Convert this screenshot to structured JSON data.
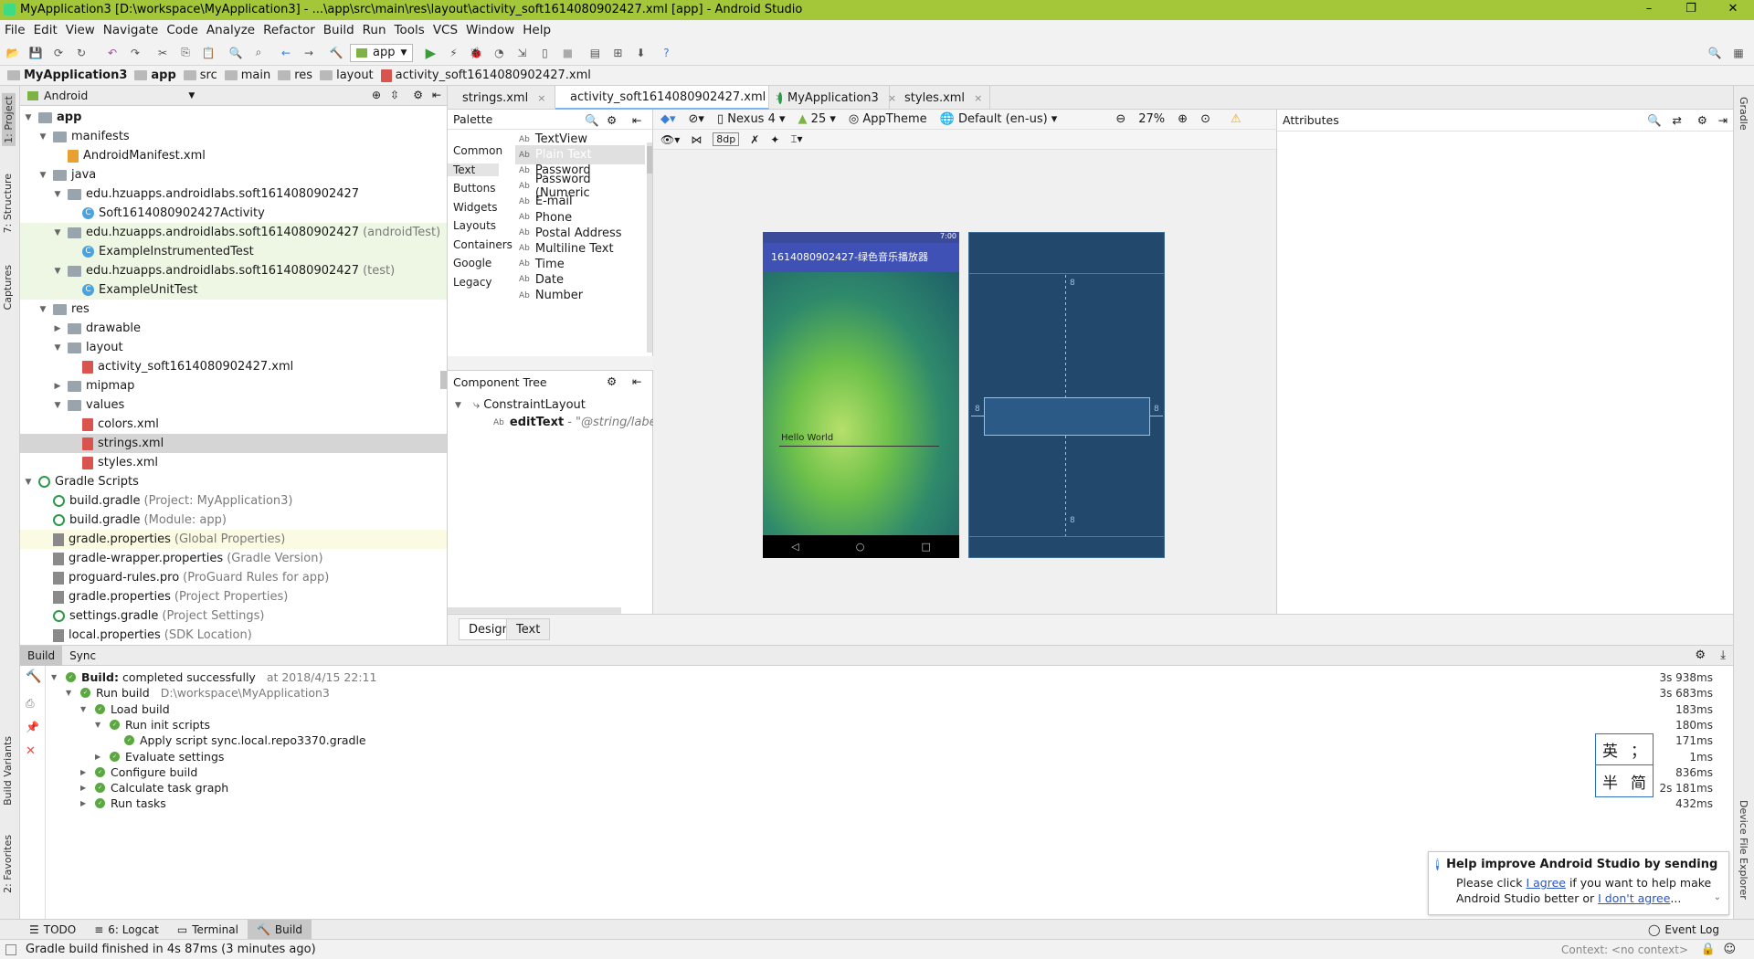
{
  "window": {
    "title": "MyApplication3 [D:\\workspace\\MyApplication3] - ...\\app\\src\\main\\res\\layout\\activity_soft1614080902427.xml [app] - Android Studio"
  },
  "menu": [
    "File",
    "Edit",
    "View",
    "Navigate",
    "Code",
    "Analyze",
    "Refactor",
    "Build",
    "Run",
    "Tools",
    "VCS",
    "Window",
    "Help"
  ],
  "toolbar": {
    "run_config": "app"
  },
  "breadcrumb": [
    "MyApplication3",
    "app",
    "src",
    "main",
    "res",
    "layout",
    "activity_soft1614080902427.xml"
  ],
  "project": {
    "view_mode": "Android",
    "tree": [
      {
        "label": "app",
        "depth": 0,
        "icon": "folder",
        "arrow": "v",
        "bold": true
      },
      {
        "label": "manifests",
        "depth": 1,
        "icon": "folder",
        "arrow": "v"
      },
      {
        "label": "AndroidManifest.xml",
        "depth": 2,
        "icon": "file",
        "arrow": ""
      },
      {
        "label": "java",
        "depth": 1,
        "icon": "folder",
        "arrow": "v"
      },
      {
        "label": "edu.hzuapps.androidlabs.soft1614080902427",
        "depth": 2,
        "icon": "folder",
        "arrow": "v"
      },
      {
        "label": "Soft1614080902427Activity",
        "depth": 3,
        "icon": "class",
        "arrow": ""
      },
      {
        "label": "edu.hzuapps.androidlabs.soft1614080902427",
        "suffix": "(androidTest)",
        "depth": 2,
        "icon": "folder",
        "arrow": "v",
        "hl": true
      },
      {
        "label": "ExampleInstrumentedTest",
        "depth": 3,
        "icon": "class",
        "arrow": "",
        "hl": true
      },
      {
        "label": "edu.hzuapps.androidlabs.soft1614080902427",
        "suffix": "(test)",
        "depth": 2,
        "icon": "folder",
        "arrow": "v",
        "hl": true
      },
      {
        "label": "ExampleUnitTest",
        "depth": 3,
        "icon": "class",
        "arrow": "",
        "hl": true
      },
      {
        "label": "res",
        "depth": 1,
        "icon": "folder",
        "arrow": "v"
      },
      {
        "label": "drawable",
        "depth": 2,
        "icon": "folder",
        "arrow": ">"
      },
      {
        "label": "layout",
        "depth": 2,
        "icon": "folder",
        "arrow": "v"
      },
      {
        "label": "activity_soft1614080902427.xml",
        "depth": 3,
        "icon": "xml",
        "arrow": ""
      },
      {
        "label": "mipmap",
        "depth": 2,
        "icon": "folder",
        "arrow": ">"
      },
      {
        "label": "values",
        "depth": 2,
        "icon": "folder",
        "arrow": "v"
      },
      {
        "label": "colors.xml",
        "depth": 3,
        "icon": "xml",
        "arrow": ""
      },
      {
        "label": "strings.xml",
        "depth": 3,
        "icon": "xml",
        "arrow": "",
        "sel": true
      },
      {
        "label": "styles.xml",
        "depth": 3,
        "icon": "xml",
        "arrow": ""
      },
      {
        "label": "Gradle Scripts",
        "depth": 0,
        "icon": "gradle",
        "arrow": "v"
      },
      {
        "label": "build.gradle",
        "suffix": "(Project: MyApplication3)",
        "depth": 1,
        "icon": "gradle",
        "arrow": ""
      },
      {
        "label": "build.gradle",
        "suffix": "(Module: app)",
        "depth": 1,
        "icon": "gradle",
        "arrow": ""
      },
      {
        "label": "gradle.properties",
        "suffix": "(Global Properties)",
        "depth": 1,
        "icon": "prop",
        "arrow": "",
        "yl": true
      },
      {
        "label": "gradle-wrapper.properties",
        "suffix": "(Gradle Version)",
        "depth": 1,
        "icon": "prop",
        "arrow": ""
      },
      {
        "label": "proguard-rules.pro",
        "suffix": "(ProGuard Rules for app)",
        "depth": 1,
        "icon": "prop",
        "arrow": ""
      },
      {
        "label": "gradle.properties",
        "suffix": "(Project Properties)",
        "depth": 1,
        "icon": "prop",
        "arrow": ""
      },
      {
        "label": "settings.gradle",
        "suffix": "(Project Settings)",
        "depth": 1,
        "icon": "gradle",
        "arrow": ""
      },
      {
        "label": "local.properties",
        "suffix": "(SDK Location)",
        "depth": 1,
        "icon": "prop",
        "arrow": ""
      }
    ]
  },
  "editor_tabs": [
    {
      "label": "strings.xml"
    },
    {
      "label": "activity_soft1614080902427.xml",
      "active": true
    },
    {
      "label": "MyApplication3"
    },
    {
      "label": "styles.xml"
    }
  ],
  "palette": {
    "title": "Palette",
    "categories": [
      "Common",
      "Text",
      "Buttons",
      "Widgets",
      "Layouts",
      "Containers",
      "Google",
      "Legacy"
    ],
    "selected_category": "Text",
    "items": [
      "TextView",
      "Plain Text",
      "Password",
      "Password (Numeric",
      "E-mail",
      "Phone",
      "Postal Address",
      "Multiline Text",
      "Time",
      "Date",
      "Number"
    ],
    "selected_item": "Plain Text"
  },
  "component_tree": {
    "title": "Component Tree",
    "root": "ConstraintLayout",
    "child": "editText",
    "child_value": "- \"@string/label_t"
  },
  "design_toolbar": {
    "device": "Nexus 4",
    "api": "25",
    "theme": "AppTheme",
    "locale": "Default (en-us)",
    "zoom": "27%",
    "margin": "8dp"
  },
  "phone": {
    "time": "7:00",
    "app_title": "1614080902427-绿色音乐播放器",
    "hello": "Hello World"
  },
  "blueprint": {
    "margin_label": "8"
  },
  "attributes": {
    "title": "Attributes"
  },
  "design_tabs": [
    "Design",
    "Text"
  ],
  "build": {
    "tabs": [
      "Build",
      "Sync"
    ],
    "rows": [
      {
        "label": "Build:",
        "label2": "completed successfully",
        "extra": "at 2018/4/15 22:11",
        "depth": 0,
        "time": "3s 938ms",
        "arrow": "v"
      },
      {
        "label": "Run build",
        "extra": "D:\\workspace\\MyApplication3",
        "depth": 1,
        "time": "3s 683ms",
        "arrow": "v"
      },
      {
        "label": "Load build",
        "depth": 2,
        "time": "183ms",
        "arrow": "v"
      },
      {
        "label": "Run init scripts",
        "depth": 3,
        "time": "180ms",
        "arrow": "v"
      },
      {
        "label": "Apply script sync.local.repo3370.gradle",
        "depth": 4,
        "time": "171ms",
        "arrow": ""
      },
      {
        "label": "Evaluate settings",
        "depth": 3,
        "time": "1ms",
        "arrow": ">"
      },
      {
        "label": "Configure build",
        "depth": 2,
        "time": "836ms",
        "arrow": ">"
      },
      {
        "label": "Calculate task graph",
        "depth": 2,
        "time": "2s 181ms",
        "arrow": ">"
      },
      {
        "label": "Run tasks",
        "depth": 2,
        "time": "432ms",
        "arrow": ">"
      }
    ]
  },
  "ime": {
    "row1": [
      "英",
      "；"
    ],
    "row2": [
      "半",
      "简"
    ]
  },
  "notification": {
    "title": "Help improve Android Studio by sending us",
    "line1": "Please click",
    "agree": "I agree",
    "line1b": "if you want to help make",
    "line2": "Android Studio better or",
    "dont": "I don't agree",
    "ellipsis": "..."
  },
  "bottom_tabs": [
    {
      "label": "TODO",
      "icon": "todo-icon"
    },
    {
      "label": "6: Logcat",
      "icon": "logcat-icon"
    },
    {
      "label": "Terminal",
      "icon": "terminal-icon"
    },
    {
      "label": "Build",
      "icon": "build-icon",
      "active": true
    }
  ],
  "event_log": "Event Log",
  "status": {
    "message": "Gradle build finished in 4s 87ms (3 minutes ago)",
    "context": "Context: <no context>"
  },
  "side_tabs": {
    "left": [
      "1: Project",
      "7: Structure",
      "Captures",
      "Build Variants",
      "2: Favorites"
    ],
    "right": [
      "Gradle",
      "Device File Explorer"
    ]
  }
}
